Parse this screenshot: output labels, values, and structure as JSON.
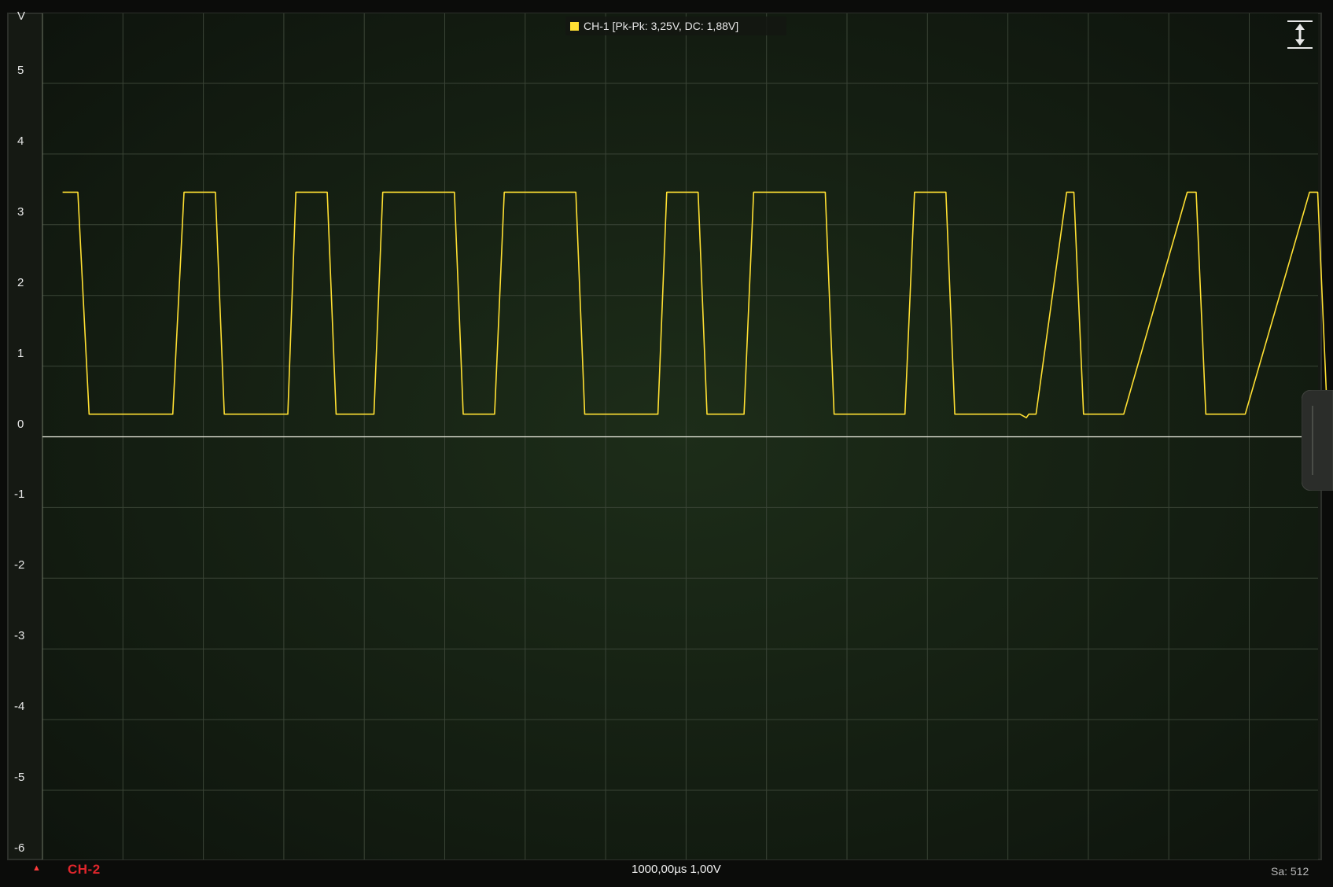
{
  "app": {
    "y_unit": "V",
    "y_ticks": [
      "5",
      "4",
      "3",
      "2",
      "1",
      "0",
      "-1",
      "-2",
      "-3",
      "-4",
      "-5",
      "-6"
    ]
  },
  "legend": {
    "channel": "CH-1",
    "text": "CH-1 [Pk-Pk: 3,25V, DC: 1,88V]",
    "color": "#ffe033"
  },
  "toolbar": {
    "autoscale_icon": "vertical-resize-icon",
    "side_handle_icon": "drawer-handle-icon"
  },
  "status": {
    "trigger_marker": "▲",
    "inactive_channel": "CH-2",
    "inactive_channel_color": "#e0262c",
    "timebase": "1000,00µs  1,00V",
    "sample_count": "Sa: 512"
  },
  "chart_data": {
    "type": "line",
    "title": "",
    "xlabel": "",
    "ylabel": "V",
    "ylim": [
      -6,
      6
    ],
    "grid": true,
    "series": [
      {
        "name": "CH-1",
        "color": "#ffe033",
        "x": [
          0.25,
          0.44,
          0.58,
          1.53,
          1.62,
          1.76,
          2.15,
          2.26,
          2.96,
          3.05,
          3.15,
          3.54,
          3.65,
          4.02,
          4.12,
          4.23,
          5.12,
          5.23,
          5.53,
          5.62,
          5.74,
          6.63,
          6.74,
          7.55,
          7.65,
          7.76,
          8.15,
          8.26,
          8.62,
          8.72,
          8.84,
          9.73,
          9.84,
          10.63,
          10.72,
          10.84,
          11.23,
          11.34,
          12.15,
          12.23,
          12.26,
          12.35,
          12.73,
          12.82,
          12.94,
          13.33,
          13.44,
          14.23,
          14.34,
          14.46,
          14.85,
          14.95,
          15.75,
          15.85,
          15.97,
          16.35,
          16.46
        ],
        "y": [
          3.46,
          3.46,
          0.32,
          0.32,
          0.32,
          3.46,
          3.46,
          0.32,
          0.32,
          0.32,
          3.46,
          3.46,
          0.32,
          0.32,
          0.32,
          3.46,
          3.46,
          0.32,
          0.32,
          0.32,
          3.46,
          3.46,
          0.32,
          0.32,
          0.32,
          3.46,
          3.46,
          0.32,
          0.32,
          0.32,
          3.46,
          3.46,
          0.32,
          0.32,
          0.32,
          3.46,
          3.46,
          0.32,
          0.32,
          0.27,
          0.32,
          0.32,
          3.46,
          3.46,
          0.32,
          0.32,
          0.32,
          3.46,
          3.46,
          0.32,
          0.32,
          0.32,
          3.46,
          3.46,
          0.32,
          0.32,
          0.32
        ]
      },
      {
        "name": "CH-2",
        "color": "#f4f4e8",
        "x": [
          0,
          16.5
        ],
        "y": [
          0,
          0
        ]
      }
    ]
  }
}
